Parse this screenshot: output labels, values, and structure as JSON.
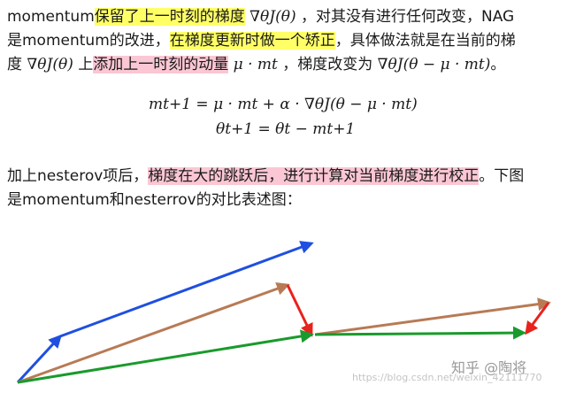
{
  "paragraph1": {
    "line1": {
      "t1": "momentum",
      "hl1": "保留了上一时刻的梯度",
      "m1": "∇θJ(θ)",
      "t2": "，对其没有进行任何改变，NAG"
    },
    "line2": {
      "t1": "是momentum的改进，",
      "hl1": "在梯度更新时做一个矫正",
      "t2": "，具体做法就是在当前的梯"
    },
    "line3": {
      "t1": "度 ",
      "m1": "∇θJ(θ)",
      "t2": " 上",
      "hl1": "添加上一时刻的动量",
      "m2": " μ · mt ",
      "t3": "，梯度改变为 ",
      "m3": "∇θJ(θ − μ · mt)",
      "t4": "。"
    }
  },
  "equations": {
    "eq1": "mt+1 = μ · mt + α · ∇θJ(θ − μ · mt)",
    "eq2": "θt+1 = θt − mt+1"
  },
  "paragraph2": {
    "line1": {
      "t1": "加上nesterov项后，",
      "hl1": "梯度在大的跳跃后，进行计算对当前梯度进行校正",
      "t2": "。下图"
    },
    "line2": {
      "t1": "是momentum和nesterrov的对比表述图："
    }
  },
  "watermark": {
    "main": "知乎 @陶将",
    "url": "https://blog.csdn.net/weixin_42111770"
  },
  "colors": {
    "highlight_yellow": "#ffff66",
    "highlight_pink": "#fbc7d4",
    "arrow_blue": "#1f4fe0",
    "arrow_brown": "#b87a55",
    "arrow_red": "#e8221d",
    "arrow_green": "#1a9a2c"
  }
}
